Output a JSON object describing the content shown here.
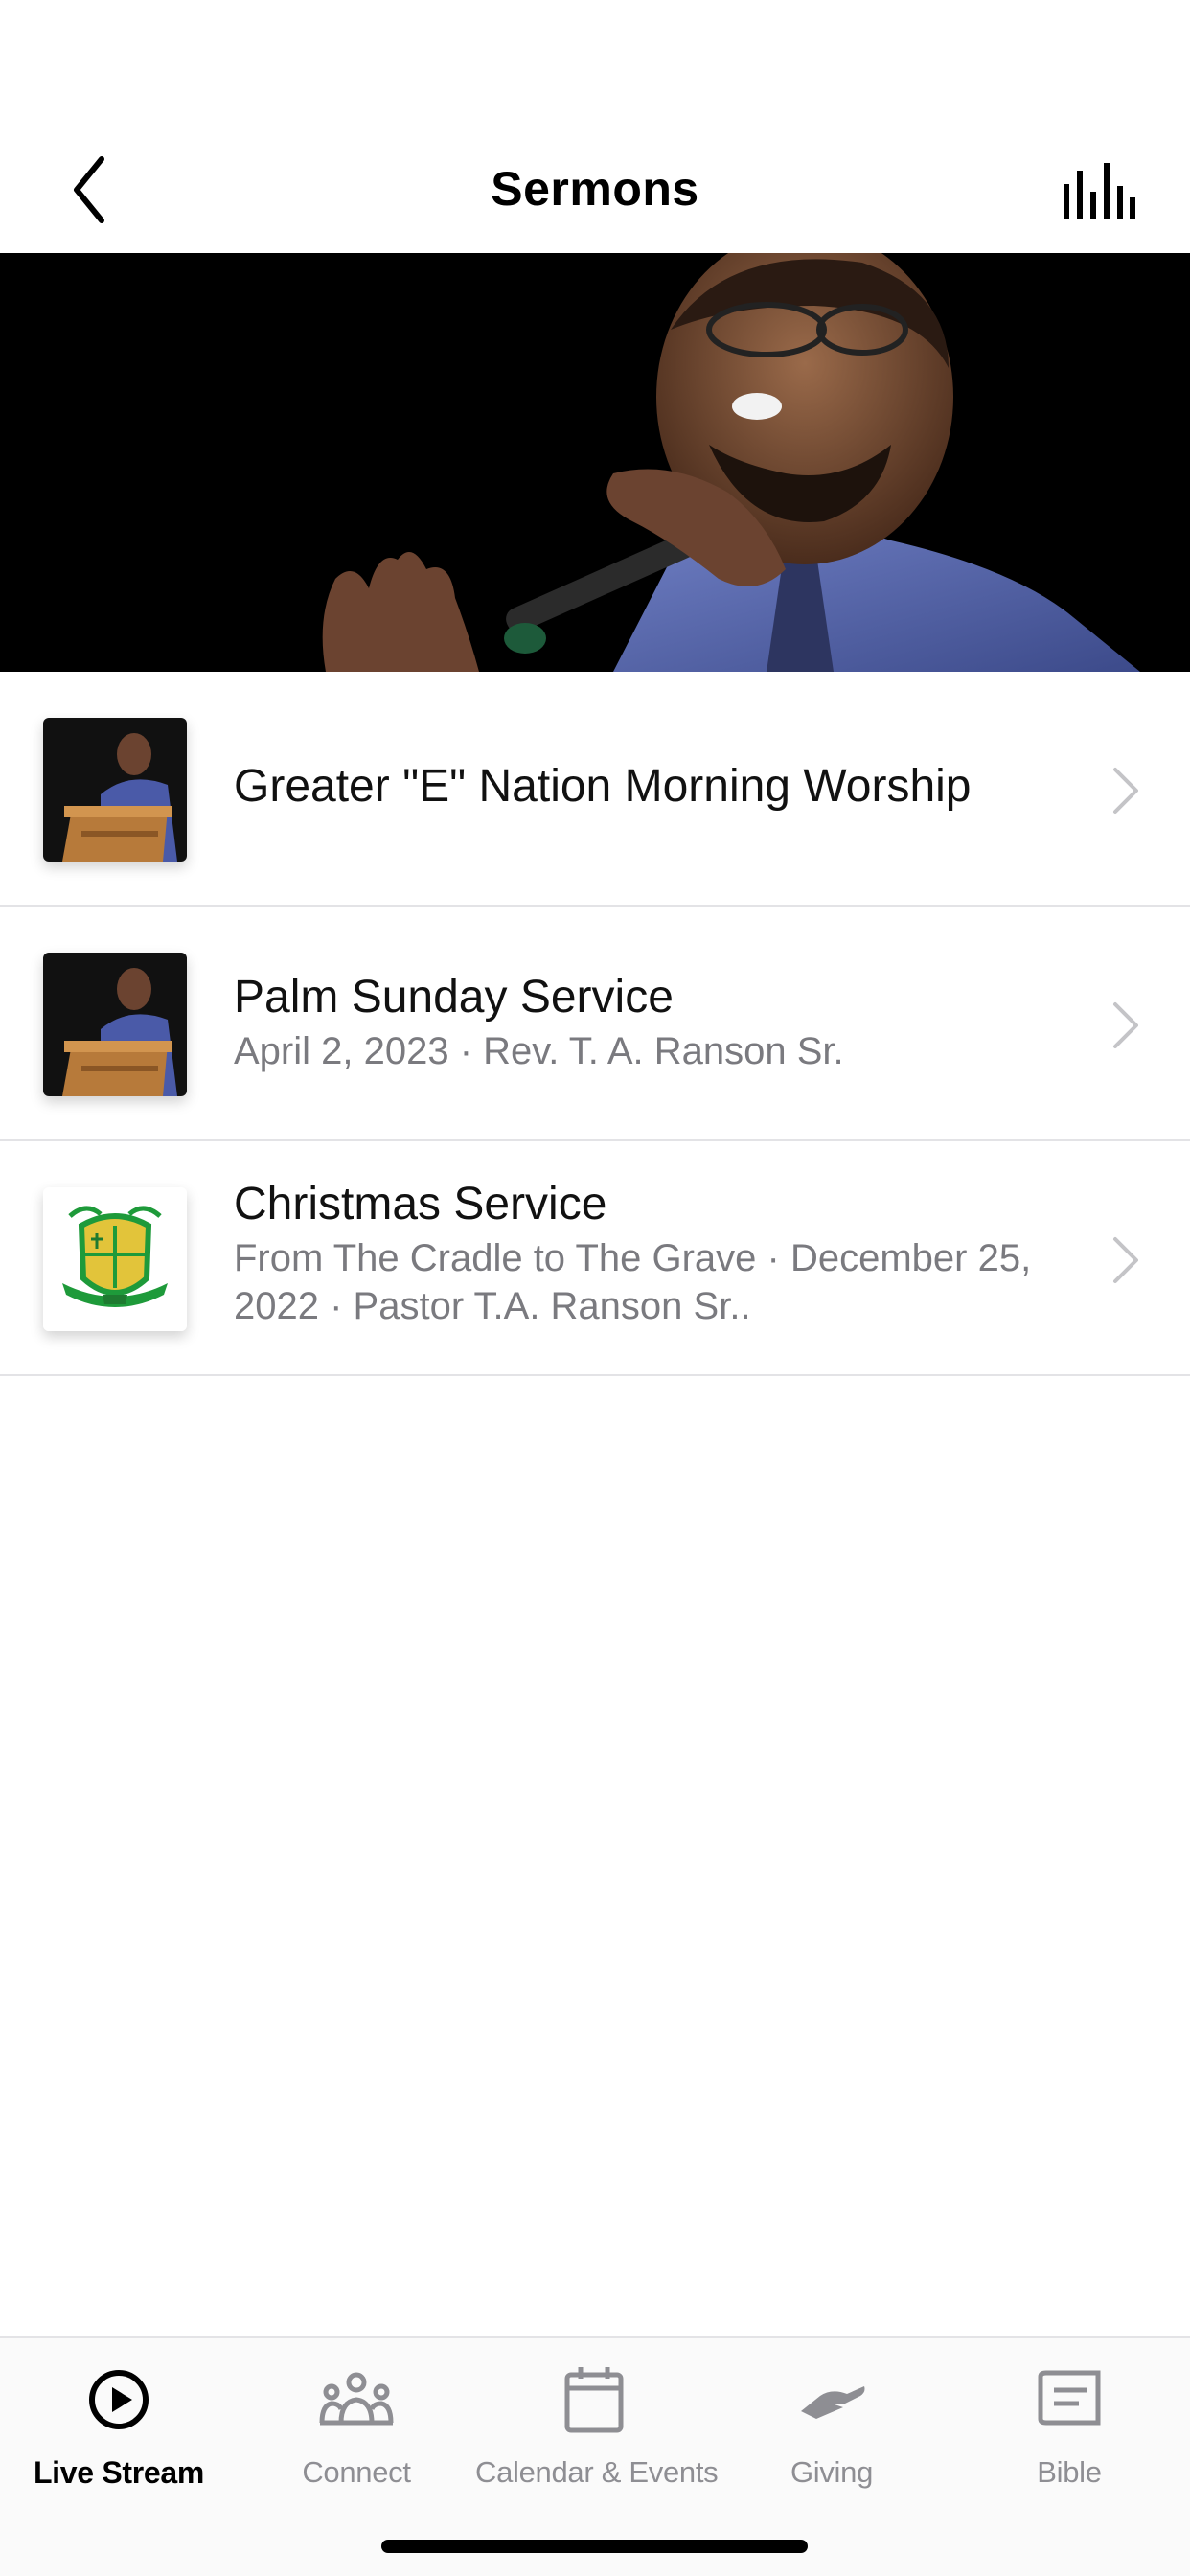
{
  "nav": {
    "title": "Sermons"
  },
  "hero": {
    "image": "preacher-speaking-at-microphone"
  },
  "sermons": [
    {
      "title": "Greater \"E\" Nation Morning Worship",
      "subtitle": "",
      "thumbnail": "preacher-at-pulpit"
    },
    {
      "title": "Palm Sunday Service",
      "subtitle": "April 2, 2023 · Rev. T. A. Ranson Sr.",
      "thumbnail": "preacher-at-pulpit"
    },
    {
      "title": "Christmas Service",
      "subtitle": "From The Cradle to The Grave · December 25, 2022 · Pastor T.A. Ranson Sr..",
      "thumbnail": "church-crest-logo"
    }
  ],
  "tabs": [
    {
      "label": "Live Stream",
      "icon": "play-circle-icon",
      "active": true
    },
    {
      "label": "Connect",
      "icon": "people-group-icon",
      "active": false
    },
    {
      "label": "Calendar & Events",
      "icon": "calendar-icon",
      "active": false
    },
    {
      "label": "Giving",
      "icon": "giving-hand-icon",
      "active": false
    },
    {
      "label": "Bible",
      "icon": "bible-icon",
      "active": false
    }
  ],
  "colors": {
    "active_tab": "#000000",
    "inactive_tab": "#8e8e93",
    "subtitle": "#7a7a7f",
    "divider": "#e3e3e6",
    "logo_green": "#1e9a3a",
    "logo_gold": "#e2c43a"
  }
}
